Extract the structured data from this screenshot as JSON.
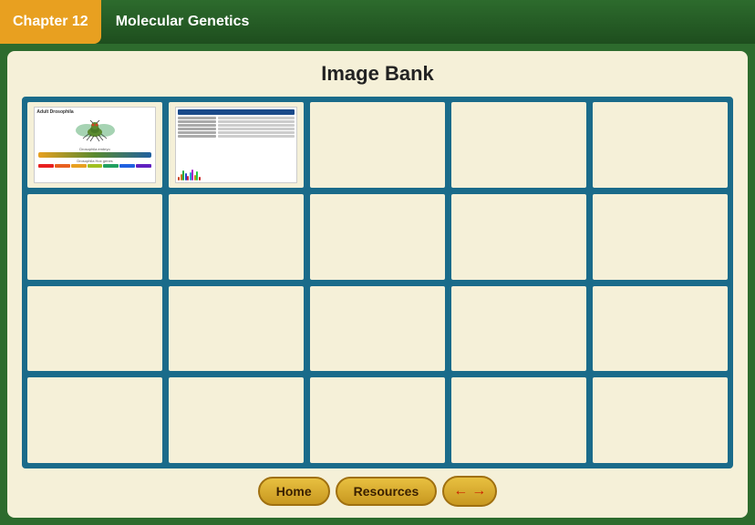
{
  "header": {
    "chapter_label": "Chapter 12",
    "subtitle": "Molecular Genetics"
  },
  "main": {
    "title": "Image Bank"
  },
  "grid": {
    "rows": 4,
    "cols": 5,
    "cells": [
      {
        "id": 0,
        "has_image": true,
        "image_type": "fly"
      },
      {
        "id": 1,
        "has_image": true,
        "image_type": "chart"
      },
      {
        "id": 2,
        "has_image": false
      },
      {
        "id": 3,
        "has_image": false
      },
      {
        "id": 4,
        "has_image": false
      },
      {
        "id": 5,
        "has_image": false
      },
      {
        "id": 6,
        "has_image": false
      },
      {
        "id": 7,
        "has_image": false
      },
      {
        "id": 8,
        "has_image": false
      },
      {
        "id": 9,
        "has_image": false
      },
      {
        "id": 10,
        "has_image": false
      },
      {
        "id": 11,
        "has_image": false
      },
      {
        "id": 12,
        "has_image": false
      },
      {
        "id": 13,
        "has_image": false
      },
      {
        "id": 14,
        "has_image": false
      },
      {
        "id": 15,
        "has_image": false
      },
      {
        "id": 16,
        "has_image": false
      },
      {
        "id": 17,
        "has_image": false
      },
      {
        "id": 18,
        "has_image": false
      },
      {
        "id": 19,
        "has_image": false
      }
    ]
  },
  "nav": {
    "home_label": "Home",
    "resources_label": "Resources",
    "back_arrow": "←",
    "forward_arrow": "→"
  }
}
